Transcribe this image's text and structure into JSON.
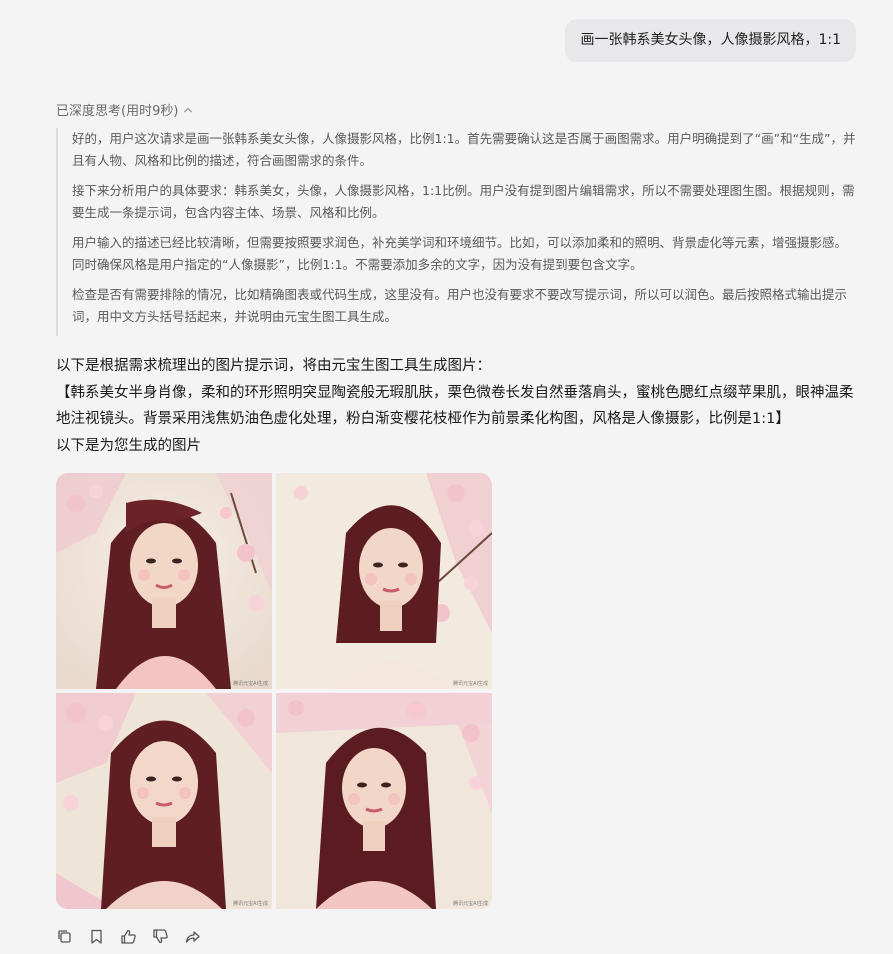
{
  "user_message": "画一张韩系美女头像，人像摄影风格，1:1",
  "thinking": {
    "header": "已深度思考(用时9秒)",
    "paragraphs": [
      "好的，用户这次请求是画一张韩系美女头像，人像摄影风格，比例1:1。首先需要确认这是否属于画图需求。用户明确提到了“画”和“生成”，并且有人物、风格和比例的描述，符合画图需求的条件。",
      "接下来分析用户的具体要求：韩系美女，头像，人像摄影风格，1:1比例。用户没有提到图片编辑需求，所以不需要处理图生图。根据规则，需要生成一条提示词，包含内容主体、场景、风格和比例。",
      "用户输入的描述已经比较清晰，但需要按照要求润色，补充美学词和环境细节。比如，可以添加柔和的照明、背景虚化等元素，增强摄影感。同时确保风格是用户指定的“人像摄影”，比例1:1。不需要添加多余的文字，因为没有提到要包含文字。",
      "检查是否有需要排除的情况，比如精确图表或代码生成，这里没有。用户也没有要求不要改写提示词，所以可以润色。最后按照格式输出提示词，用中文方头括号括起来，并说明由元宝生图工具生成。"
    ]
  },
  "answer": {
    "intro": "以下是根据需求梳理出的图片提示词，将由元宝生图工具生成图片：",
    "prompt": "【韩系美女半身肖像，柔和的环形照明突显陶瓷般无瑕肌肤，栗色微卷长发自然垂落肩头，蜜桃色腮红点缀苹果肌，眼神温柔地注视镜头。背景采用浅焦奶油色虚化处理，粉白渐变樱花枝桠作为前景柔化构图，风格是人像摄影，比例是1:1】",
    "outro": "以下是为您生成的图片"
  },
  "images": [
    {
      "name": "generated-image-1",
      "watermark": "腾讯元宝AI生成"
    },
    {
      "name": "generated-image-2",
      "watermark": "腾讯元宝AI生成"
    },
    {
      "name": "generated-image-3",
      "watermark": "腾讯元宝AI生成"
    },
    {
      "name": "generated-image-4",
      "watermark": "腾讯元宝AI生成"
    }
  ],
  "actions": [
    {
      "name": "copy-icon"
    },
    {
      "name": "bookmark-icon"
    },
    {
      "name": "thumbs-up-icon"
    },
    {
      "name": "thumbs-down-icon"
    },
    {
      "name": "share-icon"
    }
  ]
}
